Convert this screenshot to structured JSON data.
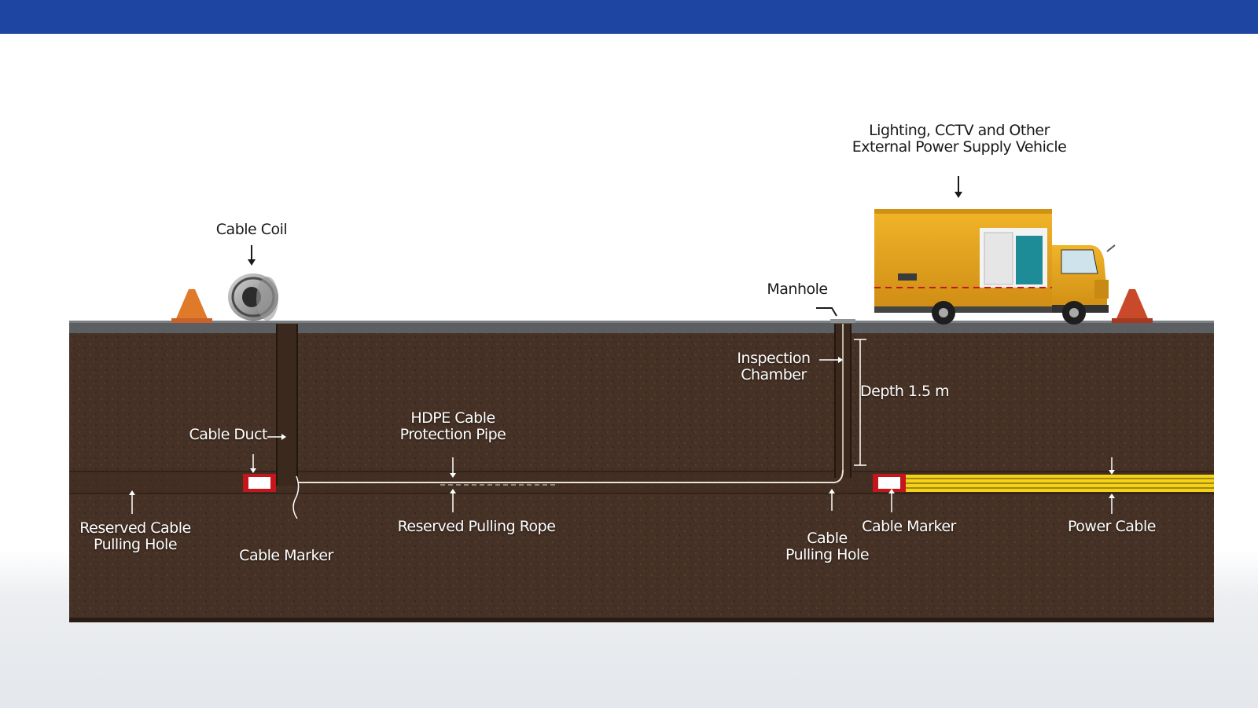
{
  "colors": {
    "header_bar": "#1f45a3",
    "soil": "#4a3527",
    "road_surface": "#5c5f61",
    "power_cable": "#f4d21a",
    "truck_body": "#e2a21e",
    "traffic_cone": "#e07a2b"
  },
  "labels": {
    "vehicle": "Lighting, CCTV and Other\nExternal Power Supply Vehicle",
    "cable_coil": "Cable Coil",
    "manhole": "Manhole",
    "inspection_chamber": "Inspection\nChamber",
    "depth": "Depth 1.5 m",
    "hdpe_pipe": "HDPE Cable\nProtection Pipe",
    "cable_duct": "Cable Duct",
    "reserved_hole": "Reserved Cable\nPulling Hole",
    "cable_marker_left": "Cable Marker",
    "reserved_rope": "Reserved Pulling Rope",
    "pulling_hole": "Cable\nPulling Hole",
    "cable_marker_right": "Cable Marker",
    "power_cable": "Power Cable"
  },
  "icons": [
    "cable-coil-icon",
    "traffic-cone-icon",
    "power-supply-truck-icon",
    "manhole-cover-icon",
    "cable-marker-icon",
    "arrow-icon"
  ]
}
